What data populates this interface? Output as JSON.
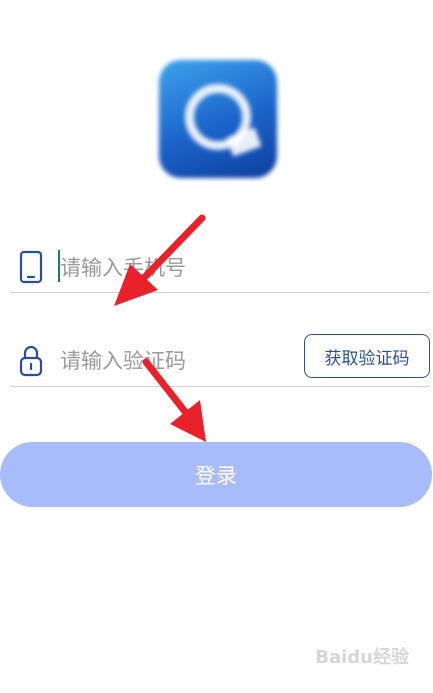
{
  "app": {
    "logo_icon": "app-logo"
  },
  "phone": {
    "icon": "smartphone-icon",
    "placeholder": "请输入手机号"
  },
  "code": {
    "icon": "padlock-icon",
    "placeholder": "请输入验证码",
    "get_code_label": "获取验证码"
  },
  "login": {
    "label": "登录"
  },
  "colors": {
    "accent": "#2a4f9a",
    "login_button": "#a8bbfa",
    "annotation_arrow": "#e8212a"
  },
  "watermark": {
    "text": "Baidu经验"
  }
}
